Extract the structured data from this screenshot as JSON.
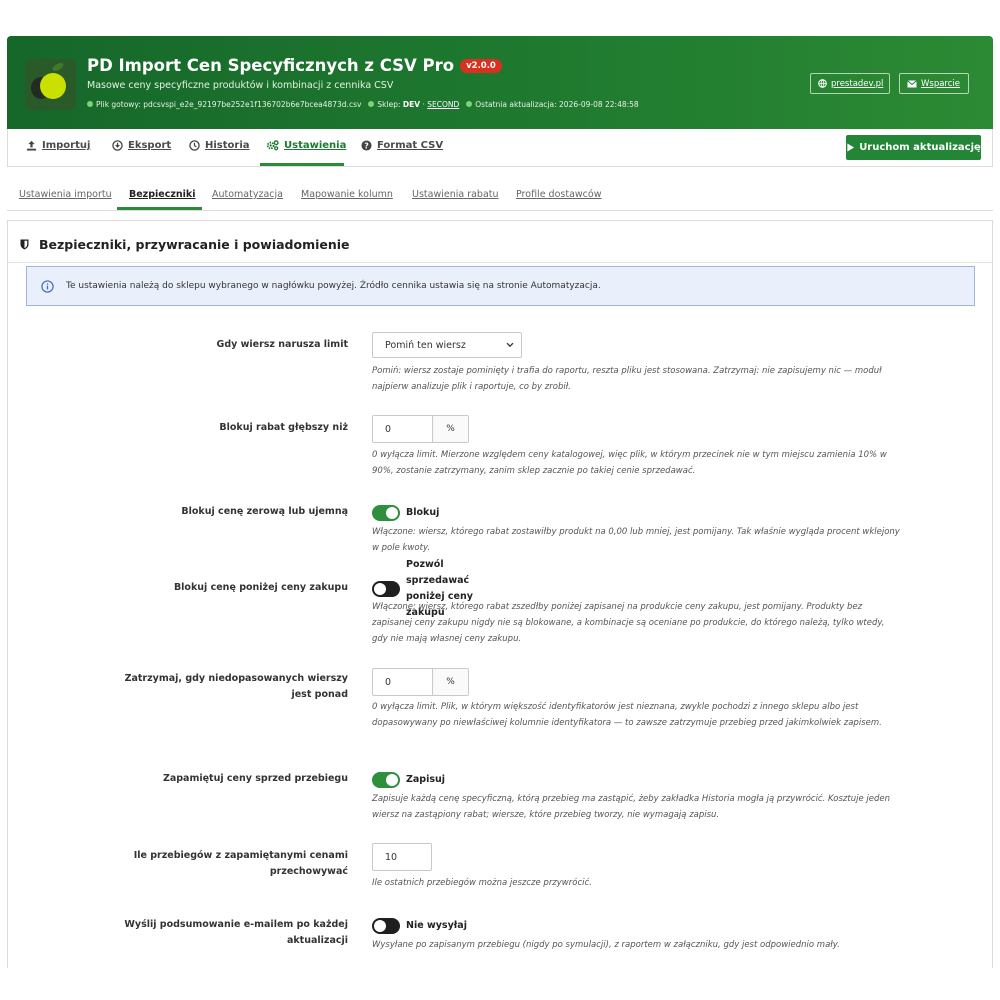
{
  "header": {
    "title": "PD Import Cen Specyficznych z CSV Pro",
    "version": "v2.0.0",
    "subtitle": "Masowe ceny specyficzne produktów i kombinacji z cennika CSV",
    "meta": {
      "file_prefix": "Plik gotowy:",
      "file_name": "pdcsvspi_e2e_92197be252e1f136702b6e7bcea4873d.csv",
      "shop_prefix": "Sklep:",
      "shop_dev": "DEV",
      "shop_sep": "·",
      "shop_second": "SECOND",
      "updated_prefix": "Ostatnia aktualizacja:",
      "updated_value": "2026-09-08 22:48:58"
    },
    "site_button": "prestadev.pl",
    "support_button": "Wsparcie"
  },
  "nav": {
    "tabs": [
      {
        "label": "Importuj",
        "icon": "upload-icon"
      },
      {
        "label": "Eksport",
        "icon": "download-icon"
      },
      {
        "label": "Historia",
        "icon": "clock-icon"
      },
      {
        "label": "Ustawienia",
        "icon": "gears-icon"
      },
      {
        "label": "Format CSV",
        "icon": "question-icon"
      }
    ],
    "active": "Ustawienia",
    "run_button": "Uruchom aktualizację"
  },
  "subnav": {
    "tabs": [
      "Ustawienia importu",
      "Bezpieczniki",
      "Automatyzacja",
      "Mapowanie kolumn",
      "Ustawienia rabatu",
      "Profile dostawców"
    ],
    "active": "Bezpieczniki"
  },
  "panel": {
    "title": "Bezpieczniki, przywracanie i powiadomienie",
    "info": "Te ustawienia należą do sklepu wybranego w nagłówku powyżej. Źródło cennika ustawia się na stronie Automatyzacja.",
    "rows": {
      "limit_action": {
        "label": "Gdy wiersz narusza limit",
        "value": "Pomiń ten wiersz",
        "help": "Pomiń: wiersz zostaje pominięty i trafia do raportu, reszta pliku jest stosowana. Zatrzymaj: nie zapisujemy nic — moduł najpierw analizuje plik i raportuje, co by zrobił."
      },
      "max_discount": {
        "label": "Blokuj rabat głębszy niż",
        "value": "0",
        "unit": "%",
        "help": "0 wyłącza limit. Mierzone względem ceny katalogowej, więc plik, w którym przecinek nie w tym miejscu zamienia 10% w 90%, zostanie zatrzymany, zanim sklep zacznie po takiej cenie sprzedawać."
      },
      "zero_price": {
        "label": "Blokuj cenę zerową lub ujemną",
        "state": "on",
        "toggle_label": "Blokuj",
        "help": "Włączone: wiersz, którego rabat zostawiłby produkt na 0,00 lub mniej, jest pomijany. Tak właśnie wygląda procent wklejony w pole kwoty."
      },
      "below_cost": {
        "label": "Blokuj cenę poniżej ceny zakupu",
        "state": "off",
        "toggle_label": "Pozwól sprzedawać poniżej ceny zakupu",
        "help": "Włączone: wiersz, którego rabat zszedłby poniżej zapisanej na produkcie ceny zakupu, jest pomijany. Produkty bez zapisanej ceny zakupu nigdy nie są blokowane, a kombinacje są oceniane po produkcie, do którego należą, tylko wtedy, gdy nie mają własnej ceny zakupu."
      },
      "unmatched": {
        "label": "Zatrzymaj, gdy niedopasowanych wierszy jest ponad",
        "value": "0",
        "unit": "%",
        "help": "0 wyłącza limit. Plik, w którym większość identyfikatorów jest nieznana, zwykle pochodzi z innego sklepu albo jest dopasowywany po niewłaściwej kolumnie identyfikatora — to zawsze zatrzymuje przebieg przed jakimkolwiek zapisem."
      },
      "remember_prices": {
        "label": "Zapamiętuj ceny sprzed przebiegu",
        "state": "on",
        "toggle_label": "Zapisuj",
        "help": "Zapisuje każdą cenę specyficzną, którą przebieg ma zastąpić, żeby zakładka Historia mogła ją przywrócić. Kosztuje jeden wiersz na zastąpiony rabat; wiersze, które przebieg tworzy, nie wymagają zapisu."
      },
      "history_count": {
        "label": "Ile przebiegów z zapamiętanymi cenami przechowywać",
        "value": "10",
        "help": "Ile ostatnich przebiegów można jeszcze przywrócić."
      },
      "email_summary": {
        "label": "Wyślij podsumowanie e-mailem po każdej aktualizacji",
        "state": "off",
        "toggle_label": "Nie wysyłaj",
        "help": "Wysyłane po zapisanym przebiegu (nigdy po symulacji), z raportem w załączniku, gdy jest odpowiednio mały."
      }
    }
  },
  "colors": {
    "header_green": "#1f7a2f",
    "accent_green": "#238636",
    "version_badge": "#d9301f",
    "info_bg": "#eaf0fb",
    "info_border": "#9fb6da"
  }
}
